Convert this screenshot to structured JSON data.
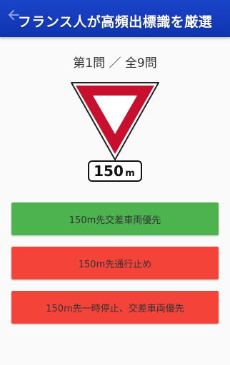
{
  "header": {
    "title": "フランス人が高頻出標識を厳選"
  },
  "question": {
    "counter": "第1問 ／ 全9問"
  },
  "sign": {
    "plate_text": "150",
    "plate_unit": "m"
  },
  "answers": [
    {
      "label": "150m先交差車両優先",
      "color": "#4db34f"
    },
    {
      "label": "150m先通行止め",
      "color": "#f4443a"
    },
    {
      "label": "150m先一時停止、交差車両優先",
      "color": "#f4443a"
    }
  ],
  "icons": {
    "back": "back-arrow-icon"
  }
}
